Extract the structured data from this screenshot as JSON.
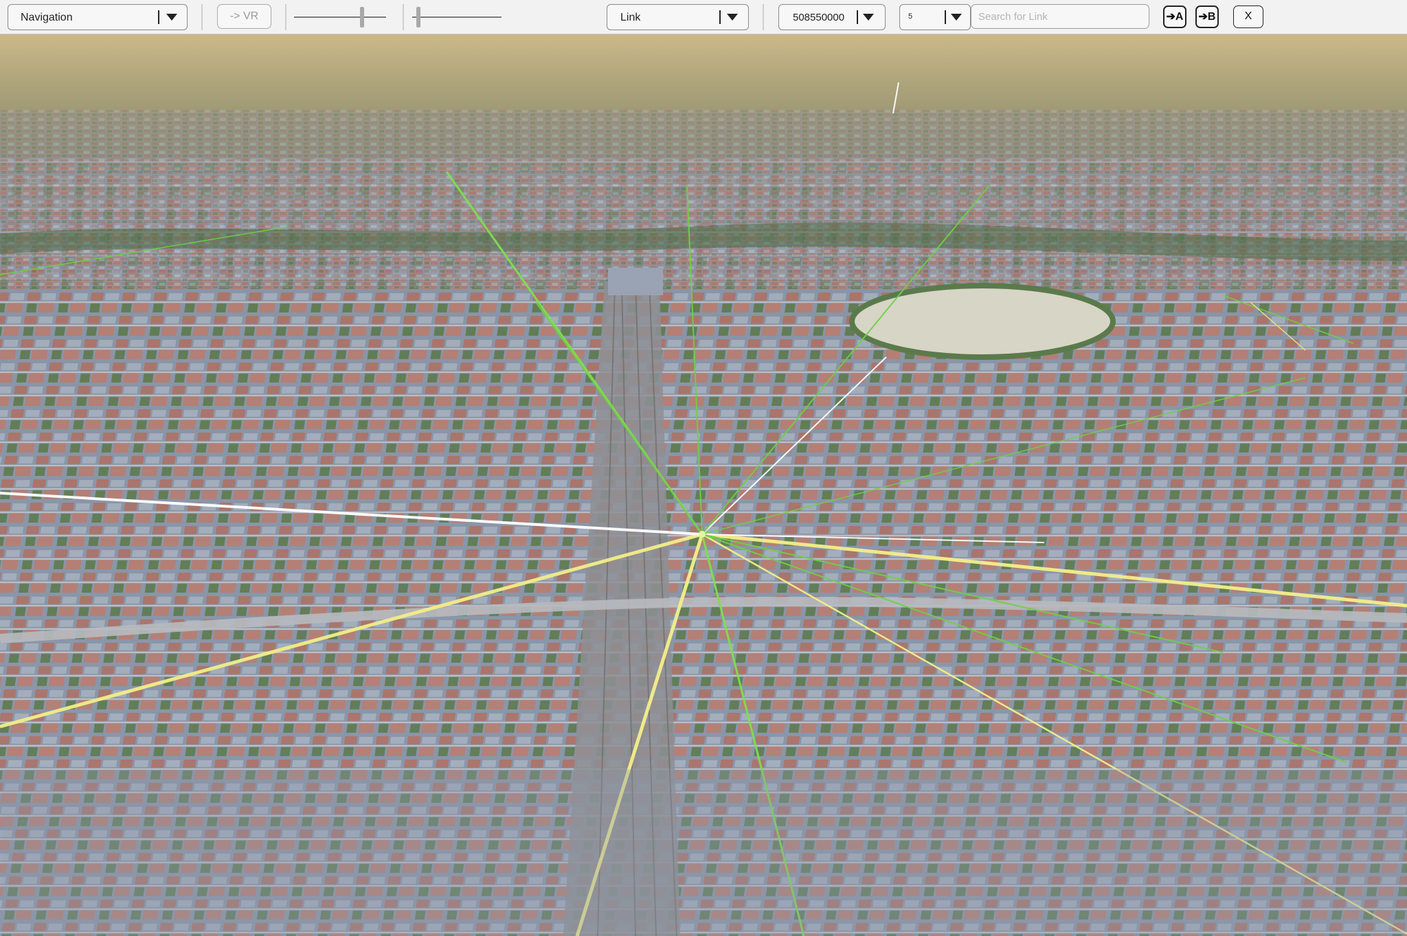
{
  "toolbar": {
    "mode_select": {
      "value": "Navigation"
    },
    "vr_button": {
      "label": "-> VR"
    },
    "type_select": {
      "value": "Link"
    },
    "time_select": {
      "value": "508550000"
    },
    "count_select": {
      "value": "5"
    },
    "search": {
      "placeholder": "Search for Link",
      "value": ""
    },
    "set_a_button": {
      "label": "➔A"
    },
    "set_b_button": {
      "label": "➔B"
    },
    "close_button": {
      "label": "X"
    },
    "slider_1": {
      "level": 0.75
    },
    "slider_2": {
      "level": 0.0
    }
  },
  "map": {
    "description_colors": {
      "sky": "#c9c0a3",
      "horizon_fields": "#b7a06a",
      "roofs": "#b4766c",
      "buildings": "#8f9bb0",
      "trees": "#4c6e3e"
    },
    "link_colors": {
      "primary": "#f4ef8a",
      "secondary": "#ffffff",
      "flow": "#7fe04b"
    }
  }
}
